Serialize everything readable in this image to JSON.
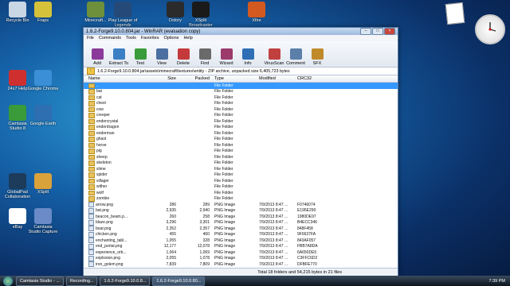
{
  "desktop": {
    "icons": [
      {
        "label": "Recycle Bin",
        "color": "#c9d6e4"
      },
      {
        "label": "Fraps",
        "color": "#d6c23a"
      },
      {
        "label": "Minecraft...",
        "color": "#6e8f3c"
      },
      {
        "label": "Play League of Legends",
        "color": "#254a7a"
      },
      {
        "label": "Dxtory",
        "color": "#2b2b2b"
      },
      {
        "label": "XSplit Broadcaster",
        "color": "#1a1a1a"
      },
      {
        "label": "Xfire",
        "color": "#d25a20"
      },
      {
        "label": "24x7 Help",
        "color": "#d02f2f"
      },
      {
        "label": "Google Chrome",
        "color": "#3b8fd6"
      },
      {
        "label": "Camtasia Studio 8",
        "color": "#3a9b3a"
      },
      {
        "label": "Google Earth",
        "color": "#2d6fb1"
      },
      {
        "label": "GlobalPad Collaboration",
        "color": "#1d3b5a"
      },
      {
        "label": "XSplit",
        "color": "#d9a23b"
      },
      {
        "label": "eBay",
        "color": "#ffffff"
      },
      {
        "label": "Camtasia Studio Capture",
        "color": "#6a8bc7"
      }
    ]
  },
  "window": {
    "title": "1.6.2-Forge9.10.0.804.jar - WinRAR (evaluation copy)",
    "menu": [
      "File",
      "Commands",
      "Tools",
      "Favorites",
      "Options",
      "Help"
    ],
    "toolbar": [
      {
        "label": "Add",
        "color": "#8b3a9b"
      },
      {
        "label": "Extract To",
        "color": "#3a7fc4"
      },
      {
        "label": "Test",
        "color": "#3a9b3a"
      },
      {
        "label": "View",
        "color": "#4a6fa0"
      },
      {
        "label": "Delete",
        "color": "#c43a3a"
      },
      {
        "label": "Find",
        "color": "#6a6a6a"
      },
      {
        "label": "Wizard",
        "color": "#9b3a6b"
      },
      {
        "label": "Info",
        "color": "#2f6fb5"
      },
      {
        "label": "VirusScan",
        "color": "#c04040"
      },
      {
        "label": "Comment",
        "color": "#5a7fa8"
      },
      {
        "label": "SFX",
        "color": "#c08a2a"
      }
    ],
    "path": "1.6.2-Forge9.10.0.804.jar\\assets\\minecraft\\textures\\entity - ZIP archive, unpacked size 6,405,723 bytes",
    "columns": [
      "Name",
      "Size",
      "Packed",
      "Type",
      "Modified",
      "CRC32"
    ],
    "rows": [
      {
        "name": "..",
        "size": "",
        "packed": "",
        "type": "File Folder",
        "modified": "",
        "crc": "",
        "kind": "folder",
        "selected": true
      },
      {
        "name": "bat",
        "size": "",
        "packed": "",
        "type": "File Folder",
        "modified": "",
        "crc": "",
        "kind": "folder"
      },
      {
        "name": "cat",
        "size": "",
        "packed": "",
        "type": "File Folder",
        "modified": "",
        "crc": "",
        "kind": "folder"
      },
      {
        "name": "chest",
        "size": "",
        "packed": "",
        "type": "File Folder",
        "modified": "",
        "crc": "",
        "kind": "folder"
      },
      {
        "name": "cow",
        "size": "",
        "packed": "",
        "type": "File Folder",
        "modified": "",
        "crc": "",
        "kind": "folder"
      },
      {
        "name": "creeper",
        "size": "",
        "packed": "",
        "type": "File Folder",
        "modified": "",
        "crc": "",
        "kind": "folder"
      },
      {
        "name": "endercrystal",
        "size": "",
        "packed": "",
        "type": "File Folder",
        "modified": "",
        "crc": "",
        "kind": "folder"
      },
      {
        "name": "enderdragon",
        "size": "",
        "packed": "",
        "type": "File Folder",
        "modified": "",
        "crc": "",
        "kind": "folder"
      },
      {
        "name": "enderman",
        "size": "",
        "packed": "",
        "type": "File Folder",
        "modified": "",
        "crc": "",
        "kind": "folder"
      },
      {
        "name": "ghast",
        "size": "",
        "packed": "",
        "type": "File Folder",
        "modified": "",
        "crc": "",
        "kind": "folder"
      },
      {
        "name": "horse",
        "size": "",
        "packed": "",
        "type": "File Folder",
        "modified": "",
        "crc": "",
        "kind": "folder"
      },
      {
        "name": "pig",
        "size": "",
        "packed": "",
        "type": "File Folder",
        "modified": "",
        "crc": "",
        "kind": "folder"
      },
      {
        "name": "sheep",
        "size": "",
        "packed": "",
        "type": "File Folder",
        "modified": "",
        "crc": "",
        "kind": "folder"
      },
      {
        "name": "skeleton",
        "size": "",
        "packed": "",
        "type": "File Folder",
        "modified": "",
        "crc": "",
        "kind": "folder"
      },
      {
        "name": "slime",
        "size": "",
        "packed": "",
        "type": "File Folder",
        "modified": "",
        "crc": "",
        "kind": "folder"
      },
      {
        "name": "spider",
        "size": "",
        "packed": "",
        "type": "File Folder",
        "modified": "",
        "crc": "",
        "kind": "folder"
      },
      {
        "name": "villager",
        "size": "",
        "packed": "",
        "type": "File Folder",
        "modified": "",
        "crc": "",
        "kind": "folder"
      },
      {
        "name": "wither",
        "size": "",
        "packed": "",
        "type": "File Folder",
        "modified": "",
        "crc": "",
        "kind": "folder"
      },
      {
        "name": "wolf",
        "size": "",
        "packed": "",
        "type": "File Folder",
        "modified": "",
        "crc": "",
        "kind": "folder"
      },
      {
        "name": "zombie",
        "size": "",
        "packed": "",
        "type": "File Folder",
        "modified": "",
        "crc": "",
        "kind": "folder"
      },
      {
        "name": "arrow.png",
        "size": "286",
        "packed": "289",
        "type": "PNG Image",
        "modified": "7/9/2013 8:47 ...",
        "crc": "F0746074",
        "kind": "png"
      },
      {
        "name": "bat.png",
        "size": "2,935",
        "packed": "2,940",
        "type": "PNG Image",
        "modified": "7/9/2013 8:47 ...",
        "crc": "E195E290",
        "kind": "png"
      },
      {
        "name": "beacon_beam.p...",
        "size": "260",
        "packed": "258",
        "type": "PNG Image",
        "modified": "7/9/2013 8:47 ...",
        "crc": "1980DE97",
        "kind": "png"
      },
      {
        "name": "blaze.png",
        "size": "3,296",
        "packed": "3,301",
        "type": "PNG Image",
        "modified": "7/9/2013 8:47 ...",
        "crc": "B4ECC346",
        "kind": "png"
      },
      {
        "name": "boat.png",
        "size": "2,352",
        "packed": "2,357",
        "type": "PNG Image",
        "modified": "7/9/2013 8:47 ...",
        "crc": "848F458",
        "kind": "png"
      },
      {
        "name": "chicken.png",
        "size": "455",
        "packed": "460",
        "type": "PNG Image",
        "modified": "7/9/2013 8:47 ...",
        "crc": "9F6637FA",
        "kind": "png"
      },
      {
        "name": "enchanting_tabl...",
        "size": "1,055",
        "packed": "328",
        "type": "PNG Image",
        "modified": "7/9/2013 8:47 ...",
        "crc": "843AF057",
        "kind": "png"
      },
      {
        "name": "end_portal.png",
        "size": "12,177",
        "packed": "12,078",
        "type": "PNG Image",
        "modified": "7/9/2013 8:47 ...",
        "crc": "FBB7A8DA",
        "kind": "png"
      },
      {
        "name": "experience_orb...",
        "size": "1,064",
        "packed": "1,069",
        "type": "PNG Image",
        "modified": "7/9/2013 8:47 ...",
        "crc": "6A650DE5",
        "kind": "png"
      },
      {
        "name": "explosion.png",
        "size": "2,055",
        "packed": "1,078",
        "type": "PNG Image",
        "modified": "7/9/2013 8:47 ...",
        "crc": "C3FFC6D2",
        "kind": "png"
      },
      {
        "name": "iron_golem.png",
        "size": "7,839",
        "packed": "7,809",
        "type": "PNG Image",
        "modified": "7/9/2013 8:47 ...",
        "crc": "DFBFE770",
        "kind": "png"
      }
    ],
    "status_left": "",
    "status_right": "Total 18 folders and 54,215 bytes in 21 files"
  },
  "taskbar": {
    "items": [
      {
        "label": "Camtasia Studio - ...",
        "active": false
      },
      {
        "label": "Recording...",
        "active": false
      },
      {
        "label": "1.6.2-Forge9.10.0.8...",
        "active": false
      },
      {
        "label": "1.6.2-Forge9.10.0.80...",
        "active": true
      }
    ],
    "time": "7:39 PM"
  }
}
